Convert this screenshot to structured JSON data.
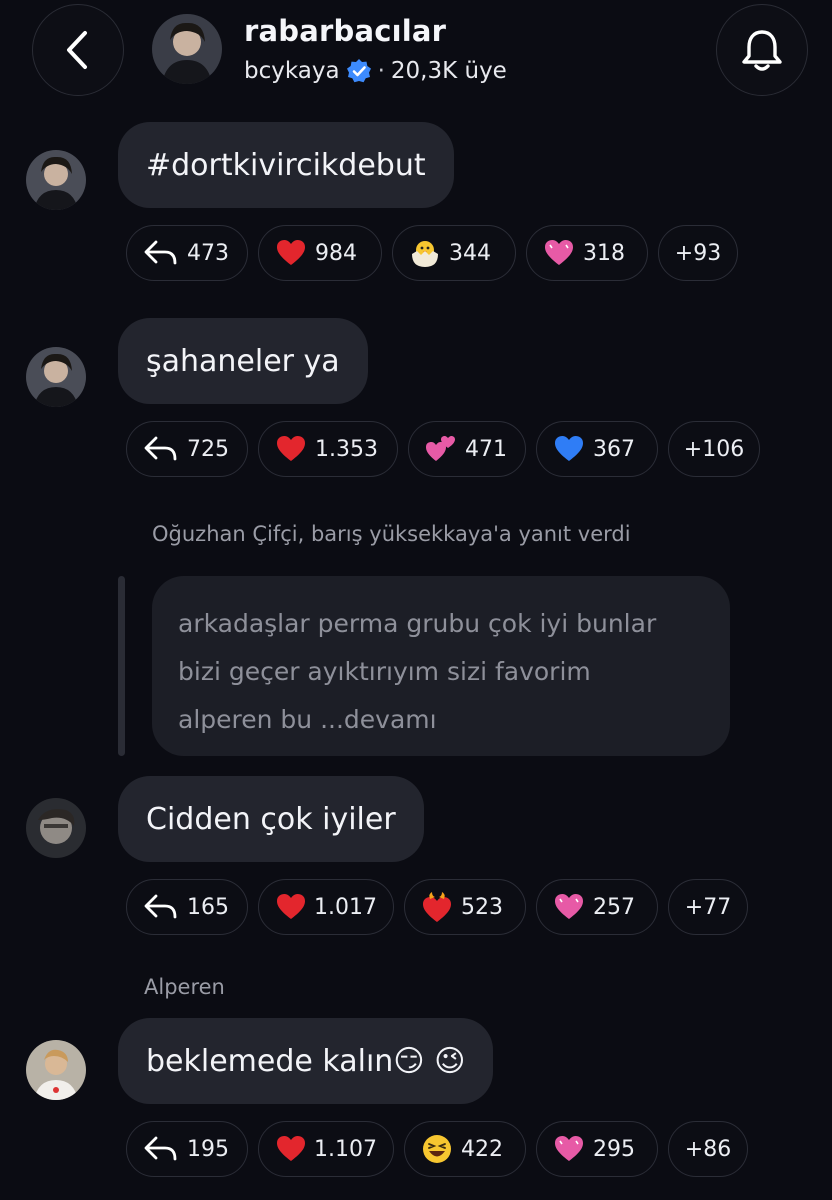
{
  "header": {
    "channel_name": "rabarbacılar",
    "owner": "bcykaya",
    "separator": "·",
    "members": "20,3K üye",
    "icons": {
      "back": "chevron-left-icon",
      "notifications": "bell-icon",
      "verified": "verified-badge-icon"
    }
  },
  "messages": [
    {
      "text": "#dortkivircikdebut",
      "reply_count": "473",
      "reactions": [
        {
          "emoji": "❤️",
          "count": "984"
        },
        {
          "emoji": "🐣",
          "count": "344"
        },
        {
          "emoji": "💗",
          "count": "318"
        }
      ],
      "more": "+93"
    },
    {
      "text": "şahaneler ya",
      "reply_count": "725",
      "reactions": [
        {
          "emoji": "❤️",
          "count": "1.353"
        },
        {
          "emoji": "💞",
          "count": "471"
        },
        {
          "emoji": "💙",
          "count": "367"
        }
      ],
      "more": "+106"
    },
    {
      "reply_meta": "Oğuzhan Çifçi, barış yüksekkaya'a yanıt verdi",
      "quoted_lines": [
        "arkadaşlar perma grubu çok iyi bunlar",
        "bizi geçer ayıktırıyım sizi favorim",
        "alperen bu ...devamı"
      ],
      "text": "Cidden çok iyiler",
      "reply_count": "165",
      "reactions": [
        {
          "emoji": "❤️‍🔥",
          "count": "523"
        }
      ],
      "reactions_full": [
        {
          "emoji": "❤️",
          "count": "1.017"
        },
        {
          "emoji": "❤️‍🔥",
          "count": "523"
        },
        {
          "emoji": "💗",
          "count": "257"
        }
      ],
      "more": "+77"
    },
    {
      "sender": "Alperen",
      "text": "beklemede kalın😏 😉",
      "reply_count": "195",
      "reactions": [
        {
          "emoji": "❤️",
          "count": "1.107"
        },
        {
          "emoji": "😆",
          "count": "422"
        },
        {
          "emoji": "💗",
          "count": "295"
        }
      ],
      "more": "+86"
    }
  ],
  "colors": {
    "background": "#0b0c13",
    "bubble": "#23252e",
    "verified": "#3d8bfd",
    "heart": "#e3262d",
    "pink_heart": "#e75aa6",
    "blue_heart": "#2f7df6"
  }
}
